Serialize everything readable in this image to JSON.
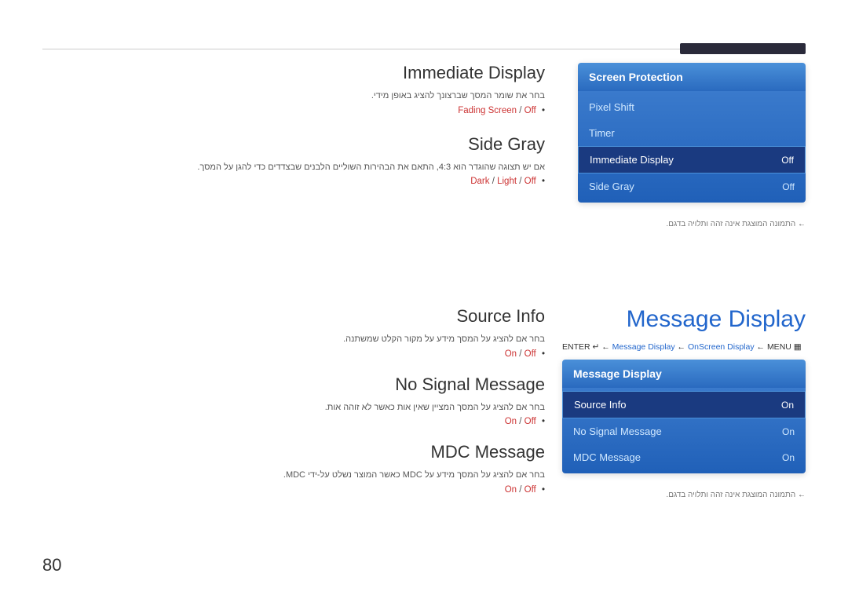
{
  "page": {
    "number": "80"
  },
  "top_section": {
    "immediate_display": {
      "title": "Immediate Display",
      "description": "בחר את שומר המסך שברצונך להציג באופן מידי.",
      "option_fading": "Fading Screen",
      "option_separator": " / ",
      "option_off": "Off",
      "bullet": "•"
    },
    "side_gray": {
      "title": "Side Gray",
      "description": "אם יש תצוגה שהוגדר הוא 4:3, התאם את הבהירות השוליים הלבנים שבצדדים כדי להגן על המסך.",
      "option_dark": "Dark",
      "sep1": " / ",
      "option_light": "Light",
      "sep2": " / ",
      "option_off": "Off",
      "bullet": "•"
    }
  },
  "bottom_section": {
    "source_info": {
      "title": "Source Info",
      "description": "בחר אם להציג על המסך מידע על מקור הקלט שמשתנה.",
      "option_on": "On",
      "separator": " / ",
      "option_off": "Off",
      "bullet": "•"
    },
    "no_signal_message": {
      "title": "No Signal Message",
      "description": "בחר אם להציג על המסך המציין שאין אות כאשר לא זוהה אות.",
      "option_on": "On",
      "separator": " / ",
      "option_off": "Off",
      "bullet": "•"
    },
    "mdc_message": {
      "title": "MDC Message",
      "description": "בחר אם להציג על המסך מידע על MDC כאשר המוצר נשלט על-ידי MDC.",
      "option_on": "On",
      "separator": " / ",
      "option_off": "Off",
      "bullet": "•"
    }
  },
  "screen_protection_panel": {
    "header": "Screen Protection",
    "items": [
      {
        "label": "Pixel Shift",
        "value": ""
      },
      {
        "label": "Timer",
        "value": ""
      },
      {
        "label": "Immediate Display",
        "value": "Off",
        "active": true
      },
      {
        "label": "Side Gray",
        "value": "Off"
      }
    ],
    "note": "התמונה המוצגת אינה זהה ותלויה בדגם."
  },
  "message_display_panel": {
    "title": "Message Display",
    "enter_prefix": "ENTER",
    "enter_arrow": "↵",
    "breadcrumb_message": "Message Display",
    "breadcrumb_arrow1": "←",
    "breadcrumb_onscreen": "OnScreen Display",
    "breadcrumb_arrow2": "←",
    "breadcrumb_menu": "MENU",
    "menu_icon": "▦",
    "panel_header": "Message Display",
    "items": [
      {
        "label": "Source Info",
        "value": "On",
        "active": true
      },
      {
        "label": "No Signal Message",
        "value": "On"
      },
      {
        "label": "MDC Message",
        "value": "On"
      }
    ],
    "note": "התמונה המוצגת אינה זהה ותלויה בדגם."
  }
}
